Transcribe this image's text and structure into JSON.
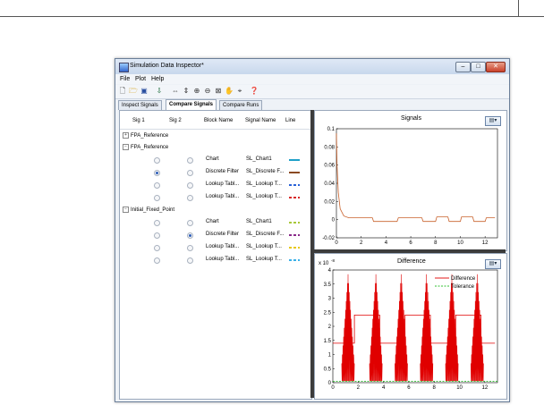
{
  "window": {
    "title": "Simulation Data Inspector*"
  },
  "menu": [
    "File",
    "Plot",
    "Help"
  ],
  "tabs": [
    {
      "label": "Inspect Signals",
      "active": false
    },
    {
      "label": "Compare Signals",
      "active": true
    },
    {
      "label": "Compare Runs",
      "active": false
    }
  ],
  "table": {
    "headers": [
      "Sig 1",
      "Sig 2",
      "Block Name",
      "Signal Name",
      "Line"
    ],
    "groups": [
      {
        "label": "FPA_Reference",
        "expanded": false,
        "rows": []
      },
      {
        "label": "FPA_Reference",
        "expanded": true,
        "rows": [
          {
            "sig1": false,
            "sig2": false,
            "block": "Chart",
            "signal": "SL_Chart1",
            "color": "#1fa0c8",
            "dash": false
          },
          {
            "sig1": true,
            "sig2": false,
            "block": "Discrete Filter",
            "signal": "SL_Discrete F...",
            "color": "#8a4a22",
            "dash": false
          },
          {
            "sig1": false,
            "sig2": false,
            "block": "Lookup Tabl...",
            "signal": "SL_Lookup T...",
            "color": "#2a62d8",
            "dash": true
          },
          {
            "sig1": false,
            "sig2": false,
            "block": "Lookup Tabl...",
            "signal": "SL_Lookup T...",
            "color": "#d82a2a",
            "dash": true
          }
        ]
      },
      {
        "label": "Initial_Fixed_Point",
        "expanded": true,
        "rows": [
          {
            "sig1": false,
            "sig2": false,
            "block": "Chart",
            "signal": "SL_Chart1",
            "color": "#a8c83a",
            "dash": true
          },
          {
            "sig1": false,
            "sig2": true,
            "block": "Discrete Filter",
            "signal": "SL_Discrete F...",
            "color": "#8a2a8a",
            "dash": true
          },
          {
            "sig1": false,
            "sig2": false,
            "block": "Lookup Tabl...",
            "signal": "SL_Lookup T...",
            "color": "#e8c81a",
            "dash": true
          },
          {
            "sig1": false,
            "sig2": false,
            "block": "Lookup Tabl...",
            "signal": "SL_Lookup T...",
            "color": "#3ab0e8",
            "dash": true
          }
        ]
      }
    ]
  },
  "chart_data": [
    {
      "type": "line",
      "title": "Signals",
      "xlim": [
        0,
        13
      ],
      "ylim": [
        -0.02,
        0.1
      ],
      "x_ticks": [
        "0",
        "2",
        "4",
        "6",
        "8",
        "10",
        "12"
      ],
      "y_ticks": [
        "0.1",
        "0.08",
        "0.06",
        "0.04",
        "0.02",
        "0",
        "-0.02"
      ],
      "color": "#c8602a",
      "x": [
        0,
        0.05,
        0.15,
        0.3,
        0.6,
        1.0,
        1.5,
        2.0,
        2.9,
        3.0,
        4.9,
        5.0,
        6.9,
        7.0,
        8.0,
        8.1,
        9.0,
        9.1,
        10.0,
        10.1,
        11.0,
        11.1,
        12.0,
        12.1,
        12.8
      ],
      "y": [
        0.095,
        0.06,
        0.03,
        0.012,
        0.004,
        0.002,
        0.002,
        0.002,
        0.002,
        -0.002,
        -0.002,
        0.002,
        0.002,
        -0.002,
        -0.002,
        0.003,
        0.003,
        -0.002,
        -0.002,
        0.003,
        0.003,
        -0.002,
        -0.002,
        0.002,
        0.002
      ]
    },
    {
      "type": "line",
      "title": "Difference",
      "y_multiplier": "x 10",
      "y_exponent": "-8",
      "xlim": [
        0,
        13
      ],
      "ylim": [
        0,
        4
      ],
      "x_ticks": [
        "0",
        "2",
        "4",
        "6",
        "8",
        "10",
        "12"
      ],
      "y_ticks": [
        "4",
        "3.5",
        "3",
        "2.5",
        "2",
        "1.5",
        "1",
        "0.5",
        "0"
      ],
      "legend": [
        {
          "name": "Difference",
          "color": "#e00000",
          "dash": false
        },
        {
          "name": "Tolerance",
          "color": "#30c030",
          "dash": true
        }
      ],
      "legend_position": "top-right",
      "difference_levels": [
        {
          "x0": 0,
          "x1": 1.7,
          "y": 1.4
        },
        {
          "x0": 1.7,
          "x1": 3.7,
          "y": 2.4
        },
        {
          "x0": 3.7,
          "x1": 5.7,
          "y": 1.4
        },
        {
          "x0": 5.7,
          "x1": 7.7,
          "y": 2.4
        },
        {
          "x0": 7.7,
          "x1": 9.7,
          "y": 1.4
        },
        {
          "x0": 9.7,
          "x1": 11.7,
          "y": 2.4
        },
        {
          "x0": 11.7,
          "x1": 12.8,
          "y": 1.4
        }
      ],
      "burst_centers": [
        1.2,
        3.4,
        5.4,
        7.4,
        9.4,
        11.4
      ],
      "burst_peak": 3.8,
      "tolerance": 0.05
    }
  ]
}
